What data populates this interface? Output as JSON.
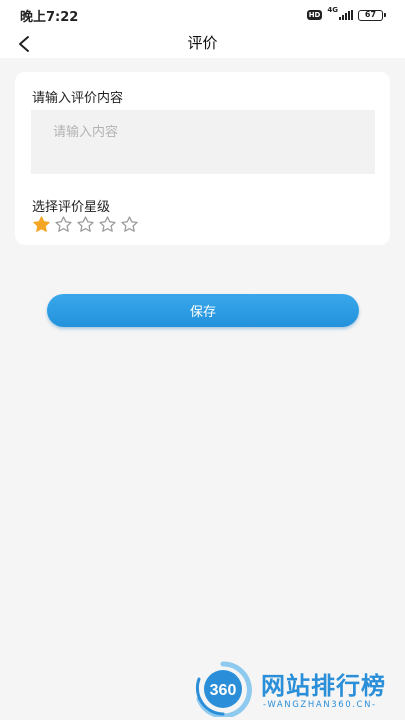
{
  "status_bar": {
    "time": "晚上7:22",
    "hd_badge": "HD",
    "network": "4G",
    "battery": "67"
  },
  "nav": {
    "title": "评价",
    "back_icon": "chevron-left-icon"
  },
  "review_form": {
    "content_label": "请输入评价内容",
    "content_value": "",
    "content_placeholder": "请输入内容",
    "rating_label": "选择评价星级",
    "rating": {
      "value": 1,
      "max": 5
    },
    "star_filled_color": "#f5a623",
    "star_empty_color": "#9a9a9a"
  },
  "save_button": {
    "label": "保存",
    "color": "#2f9fe6"
  },
  "watermark": {
    "logo_text": "360",
    "title": "网站排行榜",
    "subtitle": "-WANGZHAN360.CN-",
    "color": "#2a8fd8"
  }
}
